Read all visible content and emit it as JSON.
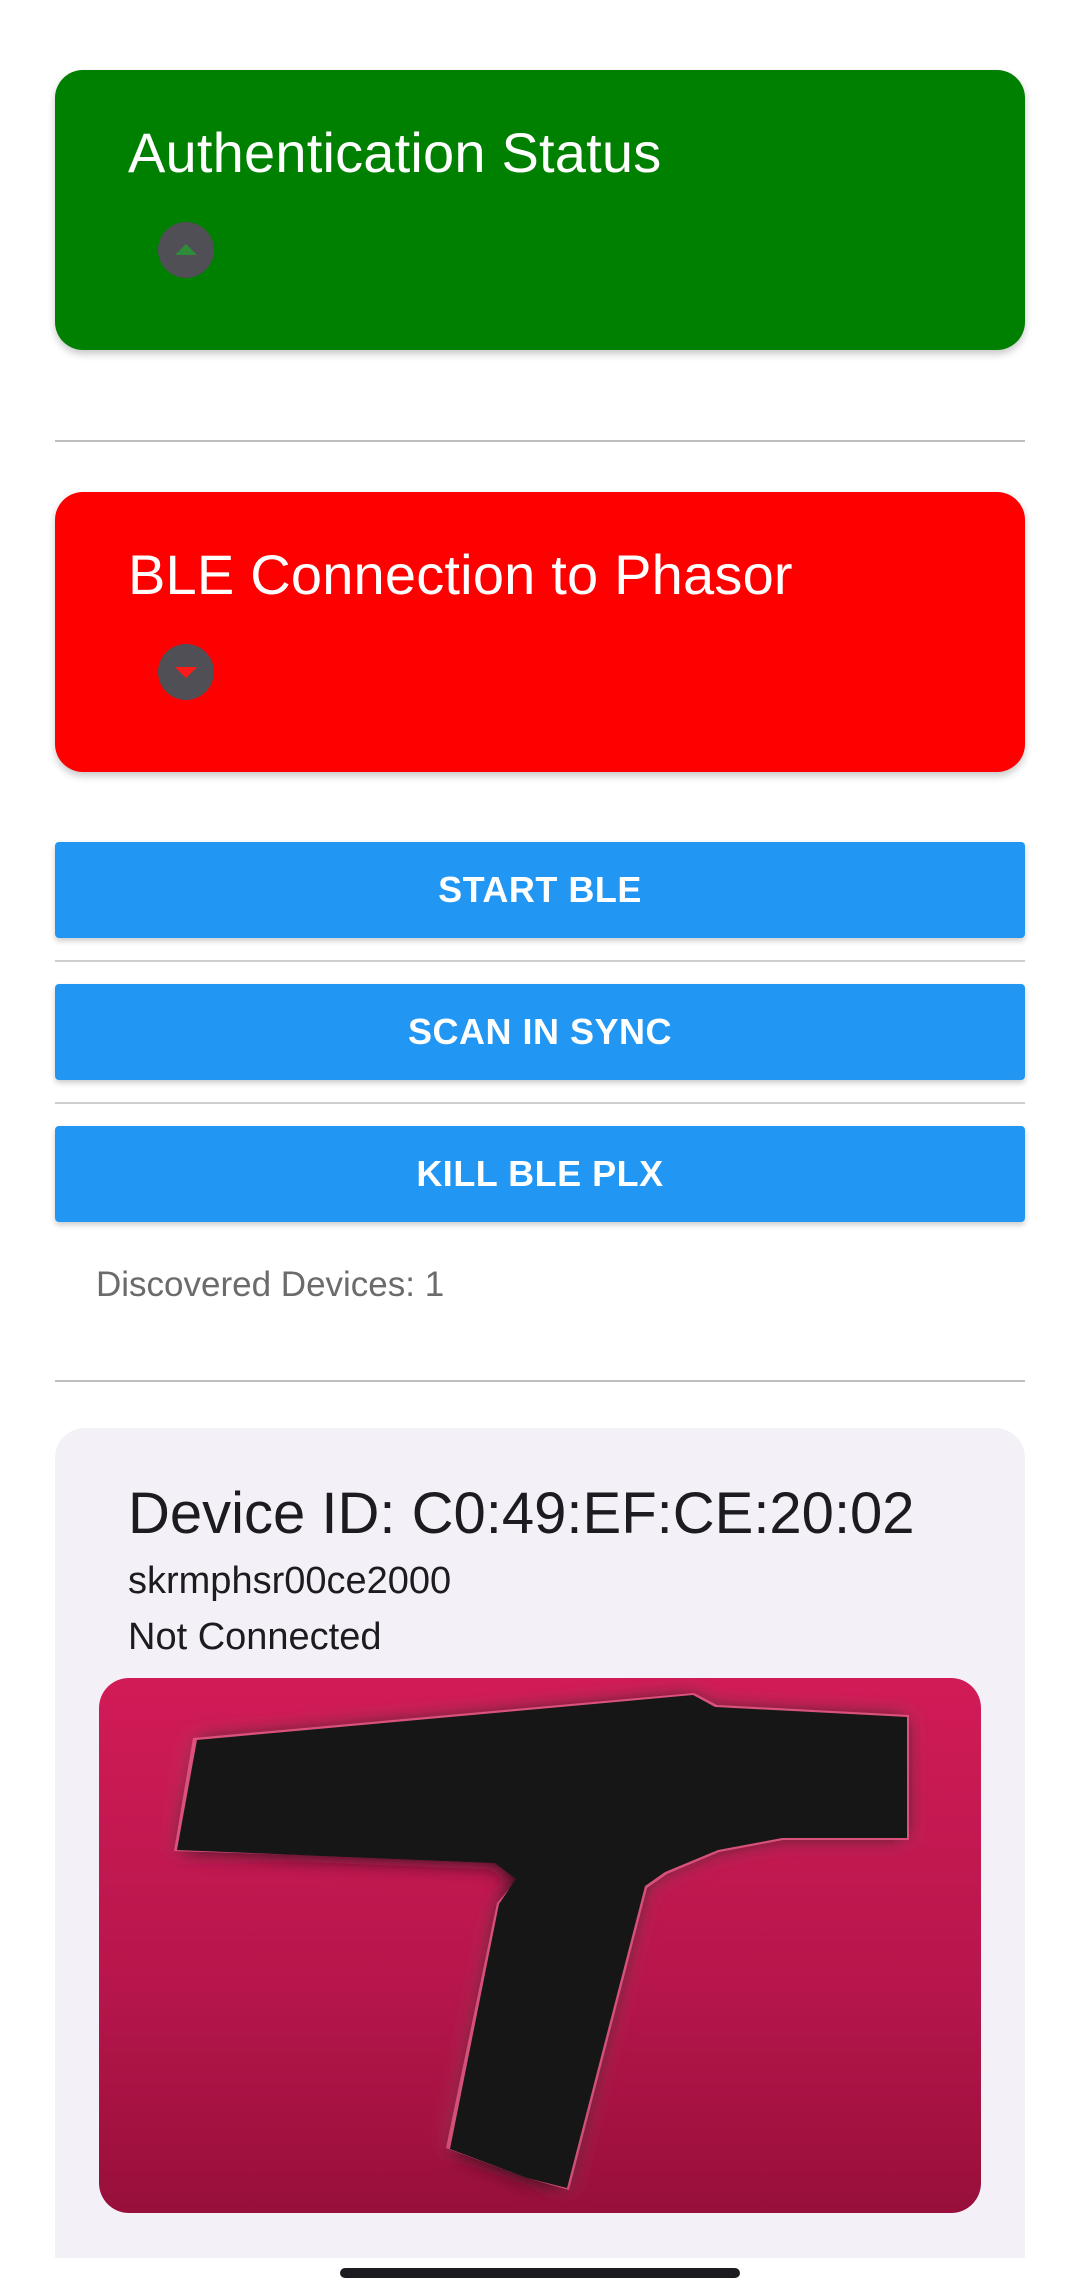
{
  "auth_card": {
    "title": "Authentication Status",
    "color": "#008000",
    "toggle_icon": "chevron-up-icon"
  },
  "ble_card": {
    "title": "BLE Connection to Phasor",
    "color": "#ff0000",
    "toggle_icon": "chevron-down-icon"
  },
  "buttons": {
    "start": "START BLE",
    "scan": "SCAN IN SYNC",
    "kill": "KILL BLE PLX",
    "color": "#2196f3"
  },
  "discovered": "Discovered Devices: 1",
  "device": {
    "id_label": "Device ID: C0:49:EF:CE:20:02",
    "name": "skrmphsr00ce2000",
    "status": "Not Connected",
    "image_icon": "phasor-device-icon"
  }
}
